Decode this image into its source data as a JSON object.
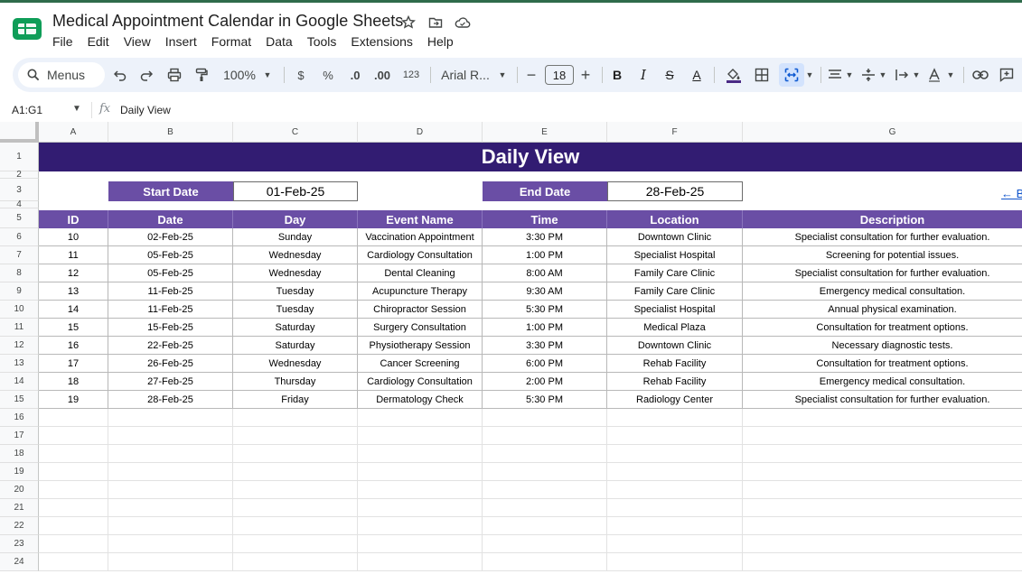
{
  "app": {
    "doc_title": "Medical Appointment Calendar in Google Sheets",
    "accent_color": "#0f9d58",
    "menu": [
      "File",
      "Edit",
      "View",
      "Insert",
      "Format",
      "Data",
      "Tools",
      "Extensions",
      "Help"
    ]
  },
  "toolbar": {
    "search_label": "Menus",
    "zoom": "100%",
    "currency": "$",
    "percent": "%",
    "dec_decrease": ".0",
    "dec_increase": ".00",
    "number_format": "123",
    "font_name": "Arial R...",
    "font_size": "18",
    "minus": "−",
    "plus": "+",
    "bold": "B",
    "italic": "I",
    "strike": "S",
    "text_color": "A",
    "text_color_b": "A"
  },
  "formula_bar": {
    "name_box": "A1:G1",
    "fx": "fx",
    "content": "Daily View"
  },
  "columns": [
    "A",
    "B",
    "C",
    "D",
    "E",
    "F",
    "G"
  ],
  "row_numbers": [
    "1",
    "2",
    "3",
    "4",
    "5",
    "6",
    "7",
    "8",
    "9",
    "10",
    "11",
    "12",
    "13",
    "14",
    "15",
    "16",
    "17",
    "18",
    "19",
    "20",
    "21",
    "22",
    "23",
    "24"
  ],
  "sheet": {
    "title": "Daily View",
    "start_label": "Start Date",
    "start_value": "01-Feb-25",
    "end_label": "End Date",
    "end_value": "28-Feb-25",
    "back_link": "← B",
    "header_color": "#6a4ea5",
    "title_color": "#321c72",
    "headers": [
      "ID",
      "Date",
      "Day",
      "Event Name",
      "Time",
      "Location",
      "Description"
    ],
    "rows": [
      [
        "10",
        "02-Feb-25",
        "Sunday",
        "Vaccination Appointment",
        "3:30 PM",
        "Downtown Clinic",
        "Specialist consultation for further evaluation."
      ],
      [
        "11",
        "05-Feb-25",
        "Wednesday",
        "Cardiology Consultation",
        "1:00 PM",
        "Specialist Hospital",
        "Screening for potential issues."
      ],
      [
        "12",
        "05-Feb-25",
        "Wednesday",
        "Dental Cleaning",
        "8:00 AM",
        "Family Care Clinic",
        "Specialist consultation for further evaluation."
      ],
      [
        "13",
        "11-Feb-25",
        "Tuesday",
        "Acupuncture Therapy",
        "9:30 AM",
        "Family Care Clinic",
        "Emergency medical consultation."
      ],
      [
        "14",
        "11-Feb-25",
        "Tuesday",
        "Chiropractor Session",
        "5:30 PM",
        "Specialist Hospital",
        "Annual physical examination."
      ],
      [
        "15",
        "15-Feb-25",
        "Saturday",
        "Surgery Consultation",
        "1:00 PM",
        "Medical Plaza",
        "Consultation for treatment options."
      ],
      [
        "16",
        "22-Feb-25",
        "Saturday",
        "Physiotherapy Session",
        "3:30 PM",
        "Downtown Clinic",
        "Necessary diagnostic tests."
      ],
      [
        "17",
        "26-Feb-25",
        "Wednesday",
        "Cancer Screening",
        "6:00 PM",
        "Rehab Facility",
        "Consultation for treatment options."
      ],
      [
        "18",
        "27-Feb-25",
        "Thursday",
        "Cardiology Consultation",
        "2:00 PM",
        "Rehab Facility",
        "Emergency medical consultation."
      ],
      [
        "19",
        "28-Feb-25",
        "Friday",
        "Dermatology Check",
        "5:30 PM",
        "Radiology Center",
        "Specialist consultation for further evaluation."
      ]
    ]
  }
}
